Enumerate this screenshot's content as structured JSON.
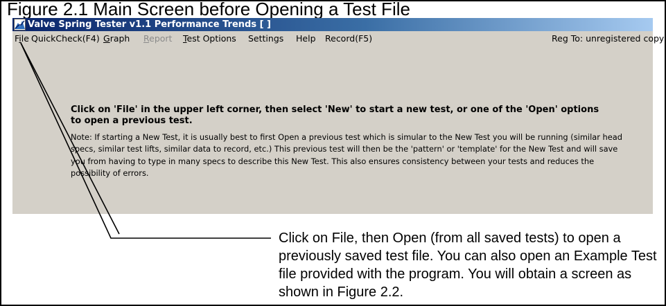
{
  "figure": {
    "title": "Figure 2.1  Main Screen before Opening a Test File"
  },
  "window": {
    "title": "Valve Spring Tester v1.1   Performance Trends   [ ]",
    "icon": "spring-app-icon"
  },
  "menu": {
    "file": {
      "pre": "F",
      "u": "i",
      "post": "le"
    },
    "quickcheck": {
      "pre": "QuickCheck(F4)",
      "u": "",
      "post": ""
    },
    "graph": {
      "pre": "",
      "u": "G",
      "post": "raph"
    },
    "report": {
      "pre": "",
      "u": "R",
      "post": "eport"
    },
    "test_options": {
      "pre": "",
      "u": "T",
      "post": "est Options"
    },
    "settings": {
      "pre": "Settings",
      "u": "",
      "post": ""
    },
    "help": {
      "pre": "Help",
      "u": "",
      "post": ""
    },
    "record": {
      "pre": "Record(F5)",
      "u": "",
      "post": ""
    },
    "registration": "Reg To: unregistered copy"
  },
  "main": {
    "instructions": "Click on 'File' in the upper left corner, then select 'New' to start a new test, or one of the 'Open' options to open a previous test.",
    "note": "Note:  If starting a New Test, it is usually best to first Open a previous test which is simular to the New Test you will be running (similar head specs, similar test lifts, similar data to record, etc.)  This previous test will then be the 'pattern' or 'template' for the New Test and will save you from having to type in many specs to describe this New Test.  This also ensures consistency between your tests and reduces the possibility of errors."
  },
  "callout": {
    "text": "Click on File, then Open (from all saved tests) to open a previously saved test file.  You can also open an Example Test file provided with the program.  You will obtain a screen as shown in Figure 2.2."
  },
  "colors": {
    "titlebar_start": "#0a246a",
    "titlebar_end": "#a6caf0",
    "window_background": "#d4d0c8",
    "disabled_menu": "#8a8a8a"
  }
}
